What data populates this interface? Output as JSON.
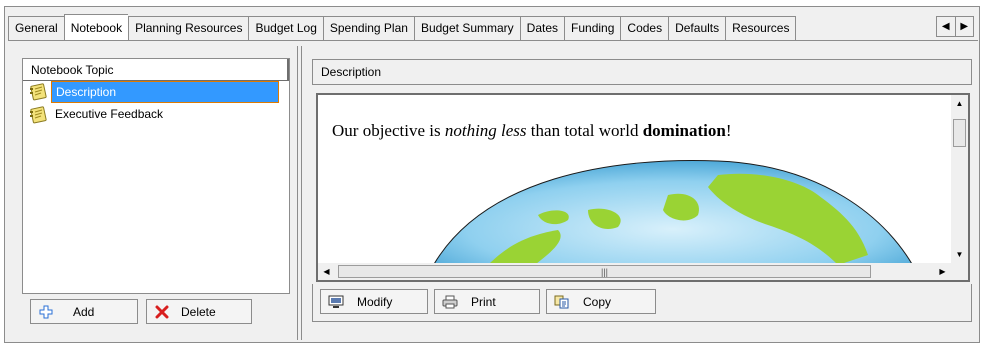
{
  "tabs": [
    {
      "label": "General",
      "active": false
    },
    {
      "label": "Notebook",
      "active": true
    },
    {
      "label": "Planning Resources",
      "active": false
    },
    {
      "label": "Budget Log",
      "active": false
    },
    {
      "label": "Spending Plan",
      "active": false
    },
    {
      "label": "Budget Summary",
      "active": false
    },
    {
      "label": "Dates",
      "active": false
    },
    {
      "label": "Funding",
      "active": false
    },
    {
      "label": "Codes",
      "active": false
    },
    {
      "label": "Defaults",
      "active": false
    },
    {
      "label": "Resources",
      "active": false
    }
  ],
  "notebook": {
    "column_header": "Notebook Topic",
    "topics": [
      {
        "label": "Description",
        "selected": true,
        "icon": "notebook-icon"
      },
      {
        "label": "Executive Feedback",
        "selected": false,
        "icon": "notebook-icon"
      }
    ],
    "add_label": "Add",
    "delete_label": "Delete"
  },
  "detail": {
    "header": "Description",
    "text_pre": "Our objective is ",
    "text_italic": "nothing less",
    "text_mid": " than total world ",
    "text_bold": "domination",
    "text_post": "!",
    "modify_label": "Modify",
    "print_label": "Print",
    "copy_label": "Copy"
  },
  "colors": {
    "selection": "#3399ff",
    "selection_border": "#e07b00",
    "globe_ocean": "#7ec8ec",
    "globe_land": "#9ad334"
  }
}
